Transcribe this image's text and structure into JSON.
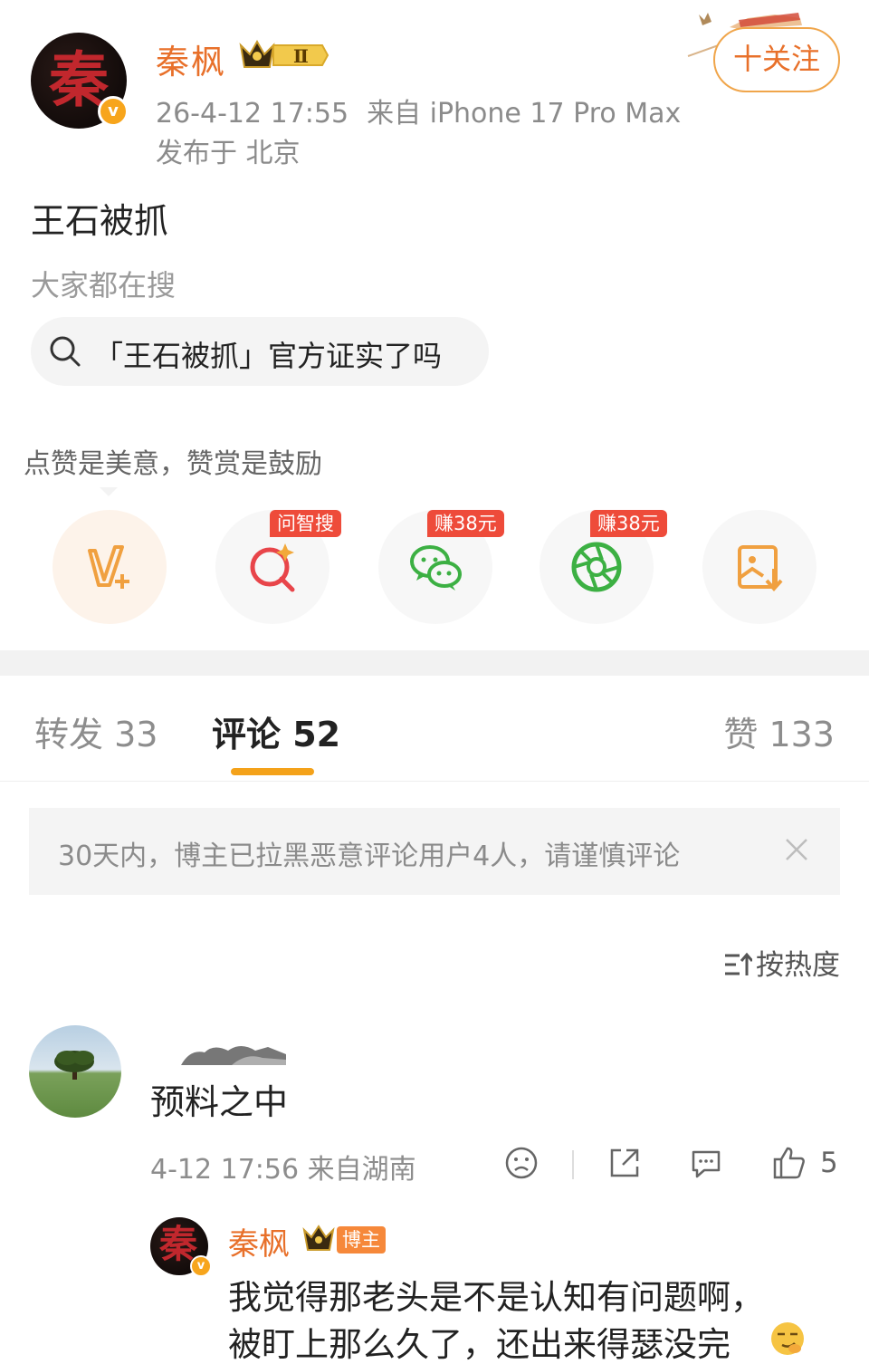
{
  "post": {
    "avatar_glyph": "秦",
    "author_name": "秦枫",
    "level_badge": "Ⅱ",
    "verified_glyph": "v",
    "timestamp": "26-4-12 17:55",
    "source": "来自 iPhone 17 Pro Max",
    "location": "发布于 北京",
    "follow_label": "十关注",
    "text": "王石被抓"
  },
  "search": {
    "hint": "大家都在搜",
    "query": "「王石被抓」官方证实了吗"
  },
  "reward": {
    "text": "点赞是美意，赞赏是鼓励",
    "actions": [
      {
        "icon": "v-plus-icon",
        "tag": ""
      },
      {
        "icon": "ai-search-icon",
        "tag": "问智搜"
      },
      {
        "icon": "wechat-icon",
        "tag": "赚38元"
      },
      {
        "icon": "moments-icon",
        "tag": "赚38元"
      },
      {
        "icon": "save-image-icon",
        "tag": ""
      }
    ]
  },
  "tabs": {
    "repost": "转发 33",
    "comments": "评论 52",
    "likes": "赞 133"
  },
  "notice": {
    "text": "30天内，博主已拉黑恶意评论用户4人，请谨慎评论"
  },
  "sort": {
    "label": "按热度"
  },
  "comment": {
    "text": "预料之中",
    "meta": "4-12 17:56 来自湖南",
    "like_count": "5"
  },
  "reply": {
    "avatar_glyph": "秦",
    "author_name": "秦枫",
    "author_tag": "博主",
    "line1": "我觉得那老头是不是认知有问题啊，",
    "line2": "被盯上那么久了，还出来得瑟没完"
  },
  "colors": {
    "accent_orange": "#e8702a",
    "tab_underline": "#f4a21a",
    "tag_red": "#ee4b3a",
    "wechat_green": "#3cb043"
  }
}
